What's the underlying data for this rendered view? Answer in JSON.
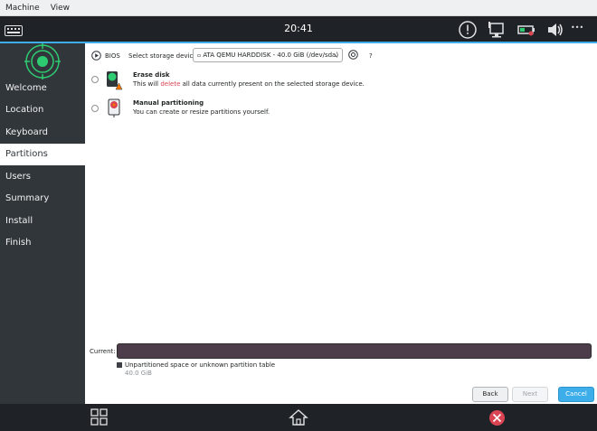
{
  "host_menu": [
    "Machine",
    "View"
  ],
  "panel": {
    "clock": "20:41",
    "more": "•••"
  },
  "sidebar": {
    "items": [
      {
        "label": "Welcome",
        "active": false
      },
      {
        "label": "Location",
        "active": false
      },
      {
        "label": "Keyboard",
        "active": false
      },
      {
        "label": "Partitions",
        "active": true
      },
      {
        "label": "Users",
        "active": false
      },
      {
        "label": "Summary",
        "active": false
      },
      {
        "label": "Install",
        "active": false
      },
      {
        "label": "Finish",
        "active": false
      }
    ]
  },
  "partitions": {
    "boot_mode": "BIOS",
    "device_label": "Select storage device:",
    "device_value": "ATA QEMU HARDDISK - 40.0 GiB (/dev/sda)",
    "help": "?",
    "erase": {
      "title": "Erase disk",
      "desc_pre": "This will ",
      "desc_em": "delete",
      "desc_post": " all data currently present on the selected storage device."
    },
    "manual": {
      "title": "Manual partitioning",
      "desc": "You can create or resize partitions yourself."
    },
    "current_label": "Current:",
    "legend_label": "Unpartitioned space or unknown partition table",
    "legend_size": "40.0 GiB"
  },
  "buttons": {
    "back": "Back",
    "next": "Next",
    "cancel": "Cancel"
  },
  "colors": {
    "accent": "#3daee9",
    "sidebar": "#31363b",
    "logo": "#2ecc71",
    "danger": "#da4453"
  }
}
